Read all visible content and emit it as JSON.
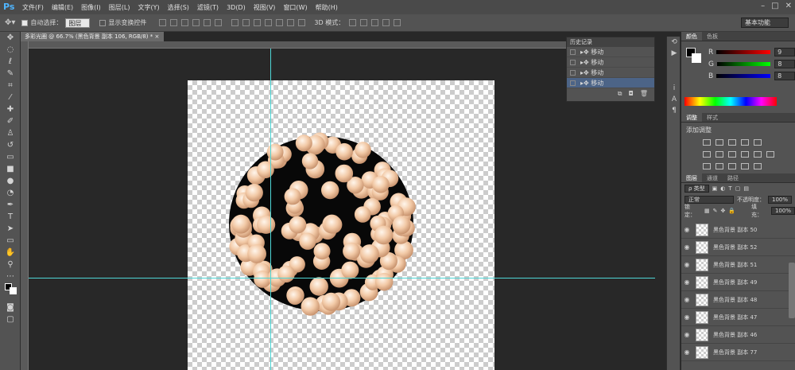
{
  "app": {
    "logo": "Ps"
  },
  "menu": [
    "文件(F)",
    "编辑(E)",
    "图像(I)",
    "图层(L)",
    "文字(Y)",
    "选择(S)",
    "滤镜(T)",
    "3D(D)",
    "视图(V)",
    "窗口(W)",
    "帮助(H)"
  ],
  "options": {
    "auto_select_label": "自动选择：",
    "auto_select_value": "图层",
    "show_transform_label": "显示变换控件",
    "mode_3d": "3D 模式：",
    "workspace": "基本功能"
  },
  "document": {
    "tab_title": "多彩光圈 @ 66.7% (黑色背景 副本 106, RGB/8) *",
    "close": "×"
  },
  "history": {
    "title": "历史记录",
    "items": [
      {
        "label": "移动"
      },
      {
        "label": "移动"
      },
      {
        "label": "移动"
      },
      {
        "label": "移动",
        "selected": true
      }
    ]
  },
  "color_panel": {
    "tabs": [
      "颜色",
      "色板"
    ],
    "r_label": "R",
    "g_label": "G",
    "b_label": "B",
    "r": "9",
    "g": "8",
    "b": "8"
  },
  "adjust_panel": {
    "tabs": [
      "调整",
      "样式"
    ],
    "title": "添加调整"
  },
  "layers_panel": {
    "tabs": [
      "图层",
      "通道",
      "路径"
    ],
    "filter": "ρ 类型",
    "blend_mode": "正常",
    "opacity_label": "不透明度：",
    "opacity": "100%",
    "lock_label": "锁定：",
    "fill_label": "填充：",
    "fill": "100%",
    "layers": [
      {
        "name": "黑色背景 副本 50"
      },
      {
        "name": "黑色背景 副本 52"
      },
      {
        "name": "黑色背景 副本 51"
      },
      {
        "name": "黑色背景 副本 49"
      },
      {
        "name": "黑色背景 副本 48"
      },
      {
        "name": "黑色背景 副本 47"
      },
      {
        "name": "黑色背景 副本 46"
      },
      {
        "name": "黑色背景 副本 77"
      }
    ]
  },
  "colors": {
    "accent": "#4c6487",
    "guide": "#4ed6d6",
    "pearl": "#f2c9a6"
  }
}
